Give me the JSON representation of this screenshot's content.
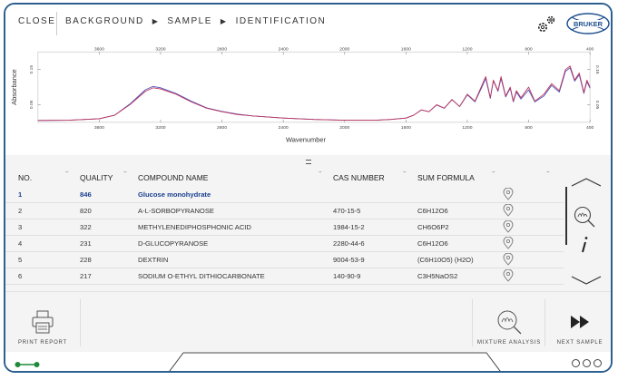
{
  "header": {
    "close_label": "CLOSE",
    "breadcrumb": [
      "BACKGROUND",
      "SAMPLE",
      "IDENTIFICATION"
    ],
    "logo_text": "BRUKER"
  },
  "chart_data": {
    "type": "line",
    "xlabel": "Wavenumber",
    "ylabel": "Absorbance",
    "x_ticks": [
      "3600",
      "3200",
      "2800",
      "2400",
      "2000",
      "1600",
      "1200",
      "800",
      "400"
    ],
    "y_ticks": [
      "0.15",
      "0.05"
    ],
    "xlim": [
      4000,
      400
    ],
    "ylim": [
      0.0,
      0.2
    ],
    "series": [
      {
        "color": "#c0365a",
        "x": [
          4000,
          3800,
          3600,
          3500,
          3400,
          3300,
          3250,
          3200,
          3100,
          3000,
          2900,
          2800,
          2700,
          2600,
          2400,
          2200,
          2000,
          1800,
          1700,
          1600,
          1550,
          1500,
          1450,
          1400,
          1350,
          1300,
          1250,
          1200,
          1150,
          1100,
          1080,
          1050,
          1030,
          1000,
          980,
          950,
          920,
          900,
          880,
          850,
          800,
          760,
          700,
          650,
          600,
          560,
          530,
          500,
          470,
          440,
          420,
          400
        ],
        "y": [
          0.005,
          0.006,
          0.01,
          0.02,
          0.05,
          0.088,
          0.098,
          0.095,
          0.08,
          0.058,
          0.04,
          0.03,
          0.022,
          0.018,
          0.012,
          0.008,
          0.006,
          0.006,
          0.008,
          0.012,
          0.02,
          0.035,
          0.03,
          0.05,
          0.04,
          0.065,
          0.045,
          0.08,
          0.06,
          0.11,
          0.13,
          0.07,
          0.12,
          0.09,
          0.13,
          0.075,
          0.1,
          0.06,
          0.09,
          0.07,
          0.1,
          0.06,
          0.08,
          0.11,
          0.09,
          0.15,
          0.16,
          0.12,
          0.14,
          0.085,
          0.12,
          0.1
        ]
      },
      {
        "color": "#4a4fc0",
        "x": [
          4000,
          3800,
          3600,
          3500,
          3400,
          3300,
          3250,
          3200,
          3100,
          3000,
          2900,
          2800,
          2700,
          2600,
          2400,
          2200,
          2000,
          1800,
          1700,
          1600,
          1550,
          1500,
          1450,
          1400,
          1350,
          1300,
          1250,
          1200,
          1150,
          1100,
          1080,
          1050,
          1030,
          1000,
          980,
          950,
          920,
          900,
          880,
          850,
          800,
          760,
          700,
          650,
          600,
          560,
          530,
          500,
          470,
          440,
          420,
          400
        ],
        "y": [
          0.005,
          0.006,
          0.01,
          0.02,
          0.052,
          0.092,
          0.102,
          0.098,
          0.082,
          0.06,
          0.041,
          0.031,
          0.023,
          0.018,
          0.012,
          0.008,
          0.006,
          0.006,
          0.008,
          0.012,
          0.02,
          0.035,
          0.03,
          0.049,
          0.04,
          0.064,
          0.045,
          0.078,
          0.058,
          0.105,
          0.125,
          0.068,
          0.118,
          0.088,
          0.125,
          0.072,
          0.097,
          0.058,
          0.086,
          0.066,
          0.092,
          0.058,
          0.075,
          0.105,
          0.086,
          0.145,
          0.155,
          0.117,
          0.135,
          0.082,
          0.116,
          0.097
        ]
      }
    ]
  },
  "table": {
    "headers": {
      "no": "NO.",
      "quality": "QUALITY",
      "compound": "COMPOUND NAME",
      "cas": "CAS NUMBER",
      "formula": "SUM FORMULA"
    },
    "rows": [
      {
        "no": "1",
        "quality": "846",
        "compound": "Glucose monohydrate",
        "cas": "",
        "formula": ""
      },
      {
        "no": "2",
        "quality": "820",
        "compound": "A-L-SORBOPYRANOSE",
        "cas": "470-15-5",
        "formula": "C6H12O6"
      },
      {
        "no": "3",
        "quality": "322",
        "compound": "METHYLENEDIPHOSPHONIC ACID",
        "cas": "1984-15-2",
        "formula": "CH6O6P2"
      },
      {
        "no": "4",
        "quality": "231",
        "compound": "D-GLUCOPYRANOSE",
        "cas": "2280-44-6",
        "formula": "C6H12O6"
      },
      {
        "no": "5",
        "quality": "228",
        "compound": "DEXTRIN",
        "cas": "9004-53-9",
        "formula": "(C6H10O5) (H2O)"
      },
      {
        "no": "6",
        "quality": "217",
        "compound": "SODIUM O-ETHYL DITHIOCARBONATE",
        "cas": "140-90-9",
        "formula": "C3H5NaOS2"
      }
    ],
    "selected_index": 0
  },
  "toolbar": {
    "print_label": "PRINT REPORT",
    "mixture_label": "MIXTURE ANALYSIS",
    "next_label": "NEXT SAMPLE"
  },
  "colors": {
    "frame": "#2d5f8f",
    "selected_row": "#1a3f8f",
    "toggle": "#1f8a3a"
  }
}
